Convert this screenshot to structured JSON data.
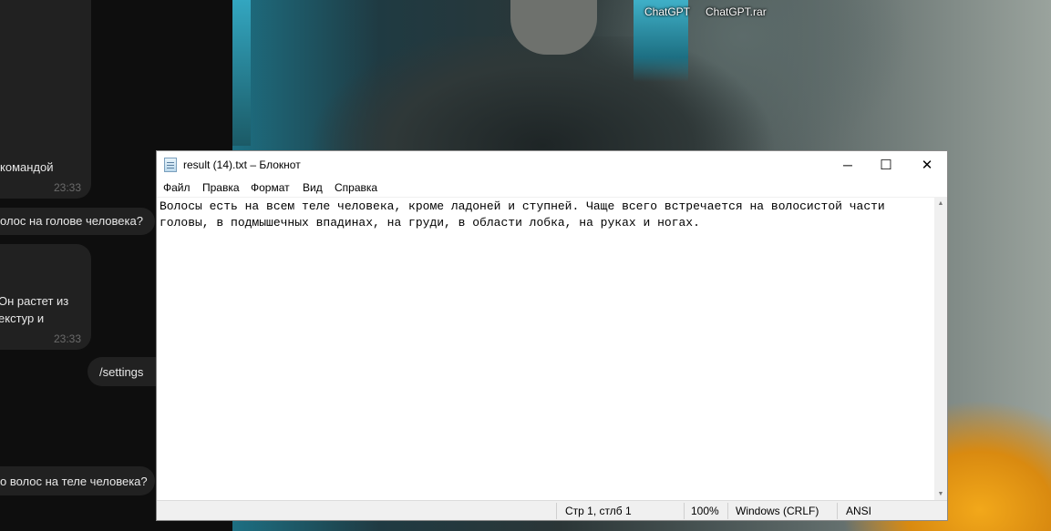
{
  "desktop": {
    "icons": [
      {
        "label": "ChatGPT"
      },
      {
        "label": "ChatGPT.rar"
      }
    ]
  },
  "chat": {
    "messages": [
      {
        "text": "командой",
        "time": "23:33"
      },
      {
        "text": "олос на голове человека?"
      },
      {
        "line1": "Он растет из",
        "line2": "екстур и",
        "time": "23:33"
      },
      {
        "text": "/settings"
      },
      {
        "text": "о волос на теле человека?"
      }
    ]
  },
  "notepad": {
    "title": "result (14).txt – Блокнот",
    "controls": {
      "minimize": "─",
      "maximize": "☐",
      "close": "✕"
    },
    "menu": [
      "Файл",
      "Правка",
      "Формат",
      "Вид",
      "Справка"
    ],
    "content": "Волосы есть на всем теле человека, кроме ладоней и ступней. Чаще всего встречается на волосистой части\nголовы, в подмышечных впадинах, на груди, в области лобка, на руках и ногах.",
    "status": {
      "position": "Стр 1, стлб 1",
      "zoom": "100%",
      "line_ending": "Windows (CRLF)",
      "encoding": "ANSI"
    }
  }
}
